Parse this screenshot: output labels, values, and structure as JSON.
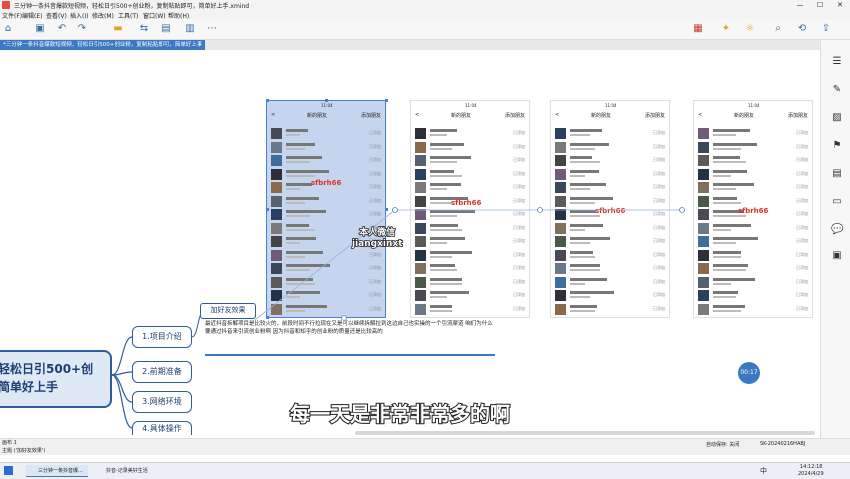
{
  "window": {
    "title": "三分钟一条抖音爆款短视频，轻松日引500+创业粉，复制粘贴即可，简单好上手.xmind",
    "minimize": "—",
    "maximize": "☐",
    "close": "✕"
  },
  "menu": [
    "文件(F)",
    "编辑(E)",
    "查看(V)",
    "插入(I)",
    "修改(M)",
    "工具(T)",
    "窗口(W)",
    "帮助(H)"
  ],
  "tab": {
    "label": "*三分钟一条抖音爆款短视频，轻松日引500+创业粉，复制粘贴即可，简单好上手",
    "close": "✕"
  },
  "phones": [
    {
      "time": "11:04",
      "title": "新的朋友",
      "back": "<",
      "add": "添加朋友",
      "status": "已添加",
      "watermark": "sfbrh66"
    },
    {
      "time": "11:04",
      "title": "新的朋友",
      "back": "<",
      "add": "添加朋友",
      "status": "已添加",
      "watermark": "sfbrh66"
    },
    {
      "time": "11:04",
      "title": "新的朋友",
      "back": "<",
      "add": "添加朋友",
      "status": "已添加",
      "watermark": "sfbrh66"
    },
    {
      "time": "11:04",
      "title": "新的朋友",
      "back": "<",
      "add": "添加朋友",
      "status": "已添加",
      "watermark": "sfbrh66"
    }
  ],
  "caption": {
    "line1": "本人微信",
    "line2": "jiangxinxt"
  },
  "mindmap": {
    "root_line1": "轻松日引500+创",
    "root_line2": "简单好上手",
    "topic_effect": "加好友效果",
    "branches": [
      "1.项目介绍",
      "2.前期准备",
      "3.网络环境",
      "4.具体操作"
    ],
    "description": "最近抖音拆解项目是比较火的，前段时间不行拉现在又是可以继续拆解拉到这边自己也实操的一个引流渠道 咱们为什么要通过抖音来引流创业粉啊 因为抖音和知乎的创业粉的质量还是比较高的"
  },
  "video": {
    "time": "00:17",
    "subtitle": "每一天是非常非常多的啊"
  },
  "statusbar": {
    "left": "画布 1",
    "topic": "主题 ('加好友效果')",
    "autosave": "自动保存: 关闭",
    "device": "SK-20240216HABJ"
  },
  "taskbar": {
    "app1": "三分钟一条抖音爆...",
    "app2": "抖音-记录美好生活",
    "time": "14:12:18",
    "date": "2024/4/29",
    "ime": "中"
  }
}
